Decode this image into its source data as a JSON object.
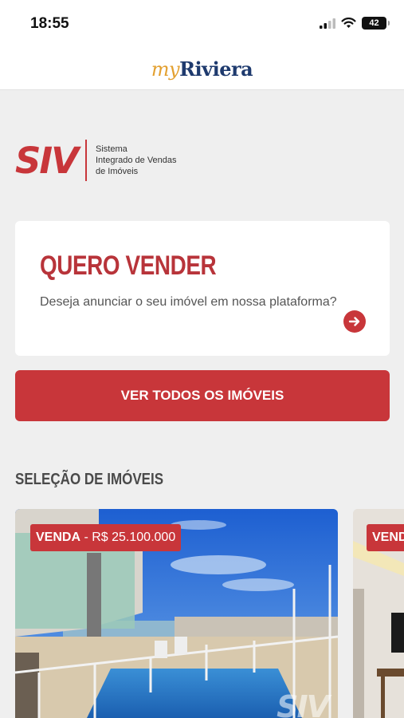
{
  "status": {
    "time": "18:55",
    "battery": "42"
  },
  "header": {
    "brand_my": "my",
    "brand_riviera": "Riviera"
  },
  "siv": {
    "mark": "SIV",
    "line1": "Sistema",
    "line2": "Integrado de Vendas",
    "line3": "de Imóveis"
  },
  "sell_card": {
    "title": "QUERO VENDER",
    "description": "Deseja anunciar o seu imóvel em nossa plataforma?"
  },
  "view_all_button": "VER TODOS OS IMÓVEIS",
  "selection": {
    "title": "SELEÇÃO DE IMÓVEIS",
    "listings": [
      {
        "type": "VENDA",
        "separator": " - ",
        "price": "R$ 25.100.000",
        "watermark": "SIV"
      },
      {
        "type": "VEND"
      }
    ]
  },
  "colors": {
    "accent": "#c8363a",
    "brand_gold": "#e3a030",
    "brand_navy": "#1e3a6e"
  }
}
